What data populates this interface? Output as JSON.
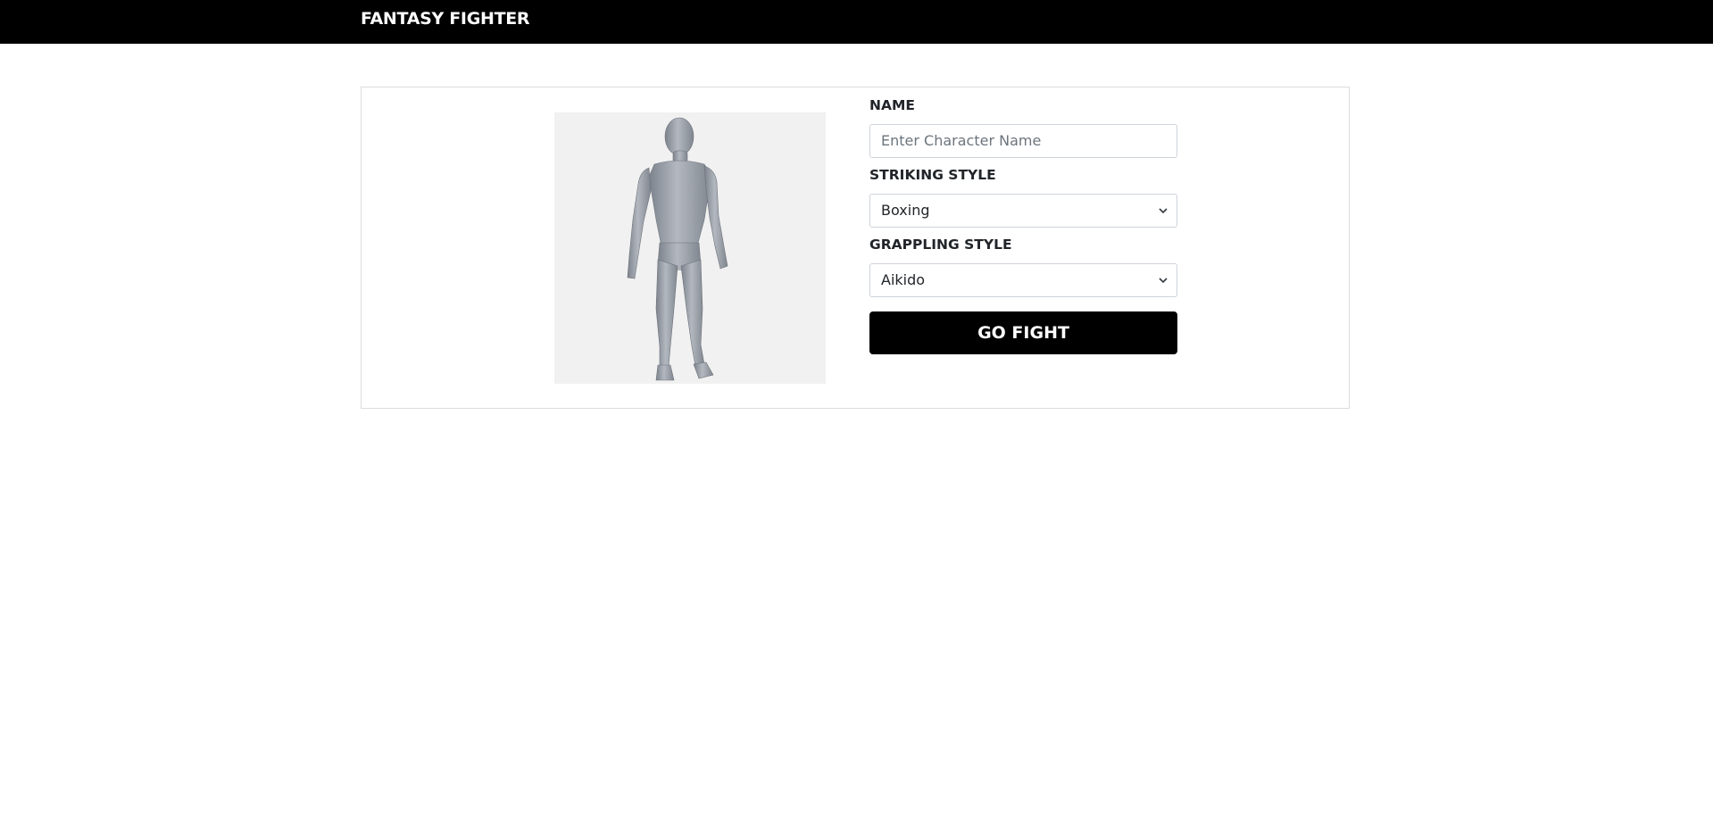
{
  "app": {
    "brand": "FANTASY FIGHTER",
    "colors": {
      "navbar": "#000000",
      "button": "#000000",
      "preview_bg": "#f1f1f1"
    }
  },
  "character": {
    "preview_image": "3d-humanoid-model"
  },
  "form": {
    "name_label": "NAME",
    "name_placeholder": "Enter Character Name",
    "name_value": "",
    "striking_label": "STRIKING STYLE",
    "striking_value": "Boxing",
    "grappling_label": "GRAPPLING STYLE",
    "grappling_value": "Aikido",
    "select_icon": "chevron-down-icon",
    "submit_label": "GO FIGHT"
  }
}
